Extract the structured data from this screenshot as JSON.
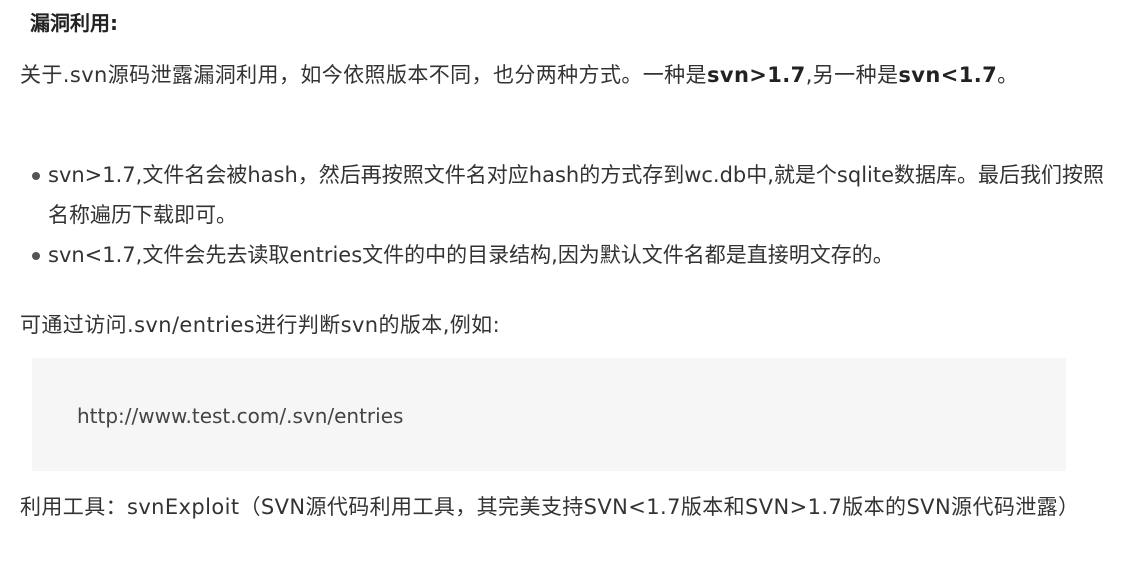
{
  "heading": "漏洞利用:",
  "intro": {
    "part1": "关于.svn源码泄露漏洞利用，如今依照版本不同，也分两种方式。一种是",
    "bold1": "svn>1.7",
    "part2": ",另一种是",
    "bold2": "svn<1.7",
    "part3": "。"
  },
  "list": [
    "svn>1.7,文件名会被hash，然后再按照文件名对应hash的方式存到wc.db中,就是个sqlite数据库。最后我们按照名称遍历下载即可。",
    "svn<1.7,文件会先去读取entries文件的中的目录结构,因为默认文件名都是直接明文存的。"
  ],
  "check_text": "可通过访问.svn/entries进行判断svn的版本,例如:",
  "code": "http://www.test.com/.svn/entries",
  "tool_text": "利用工具：svnExploit（SVN源代码利用工具，其完美支持SVN<1.7版本和SVN>1.7版本的SVN源代码泄露）"
}
